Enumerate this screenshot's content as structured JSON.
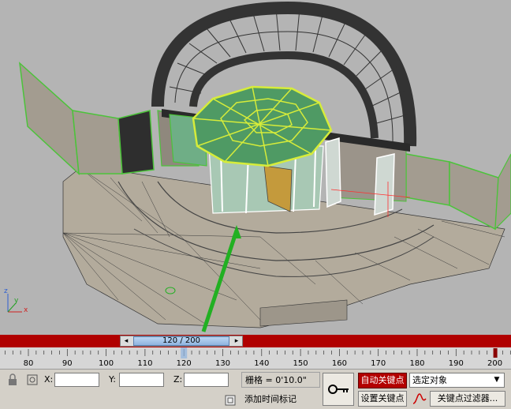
{
  "timeline": {
    "frame_label": "120 / 200",
    "left_arrow": "◂",
    "right_arrow": "▸",
    "ticks": [
      "80",
      "90",
      "100",
      "110",
      "120",
      "130",
      "140",
      "150",
      "160",
      "170",
      "180",
      "190",
      "200"
    ]
  },
  "status": {
    "x_label": "X:",
    "y_label": "Y:",
    "z_label": "Z:",
    "grid_text": "栅格 = 0'10.0\"",
    "time_tag": "添加时间标记",
    "auto_key": "自动关键点",
    "set_key": "设置关键点",
    "selection_mode": "选定对象",
    "key_filters": "关键点过滤器..."
  },
  "viewport": {
    "axis_x": "x",
    "axis_y": "y",
    "axis_z": "z"
  },
  "colors": {
    "timebar": "#b00000",
    "auto_key_bg": "#b30000",
    "selection_green": "#6fe04a"
  },
  "icons": [
    "lock-icon",
    "selection-icon",
    "key-icon",
    "time-tag-icon",
    "curve-editor-icon"
  ]
}
